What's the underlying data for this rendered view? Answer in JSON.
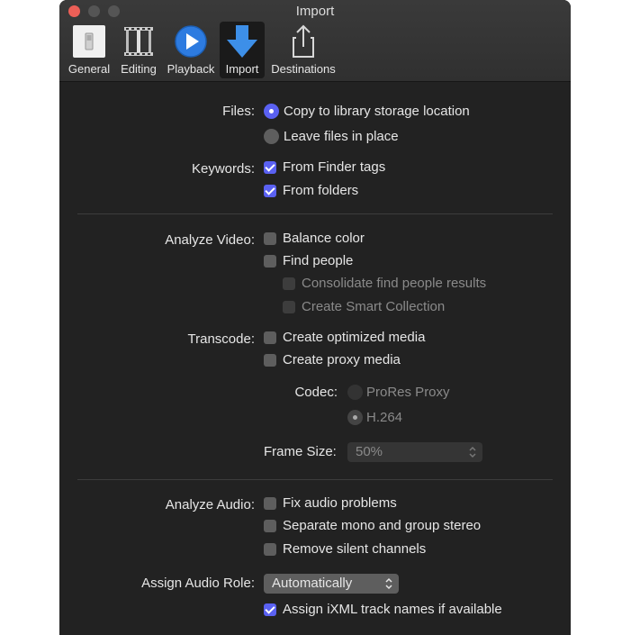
{
  "window": {
    "title": "Import"
  },
  "toolbar": {
    "items": [
      {
        "label": "General",
        "icon": "general-switch-icon"
      },
      {
        "label": "Editing",
        "icon": "filmstrip-icon"
      },
      {
        "label": "Playback",
        "icon": "play-icon"
      },
      {
        "label": "Import",
        "icon": "download-arrow-icon",
        "selected": true
      },
      {
        "label": "Destinations",
        "icon": "share-icon"
      }
    ]
  },
  "files": {
    "label": "Files:",
    "options": [
      {
        "label": "Copy to library storage location",
        "selected": true
      },
      {
        "label": "Leave files in place",
        "selected": false
      }
    ]
  },
  "keywords": {
    "label": "Keywords:",
    "options": [
      {
        "label": "From Finder tags",
        "checked": true
      },
      {
        "label": "From folders",
        "checked": true
      }
    ]
  },
  "analyze_video": {
    "label": "Analyze Video:",
    "balance_color": {
      "label": "Balance color",
      "checked": false
    },
    "find_people": {
      "label": "Find people",
      "checked": false
    },
    "consolidate": {
      "label": "Consolidate find people results",
      "checked": false,
      "enabled": false
    },
    "smart_collection": {
      "label": "Create Smart Collection",
      "checked": false,
      "enabled": false
    }
  },
  "transcode": {
    "label": "Transcode:",
    "optimized": {
      "label": "Create optimized media",
      "checked": false
    },
    "proxy": {
      "label": "Create proxy media",
      "checked": false
    },
    "codec_label": "Codec:",
    "codec_options": [
      {
        "label": "ProRes Proxy",
        "selected": false
      },
      {
        "label": "H.264",
        "selected": true
      }
    ],
    "frame_size_label": "Frame Size:",
    "frame_size_value": "50%"
  },
  "analyze_audio": {
    "label": "Analyze Audio:",
    "options": [
      {
        "label": "Fix audio problems",
        "checked": false
      },
      {
        "label": "Separate mono and group stereo",
        "checked": false
      },
      {
        "label": "Remove silent channels",
        "checked": false
      }
    ]
  },
  "audio_role": {
    "label": "Assign Audio Role:",
    "value": "Automatically",
    "ixml": {
      "label": "Assign iXML track names if available",
      "checked": true
    }
  },
  "colors": {
    "accent": "#5a61f2",
    "background": "#222222",
    "close": "#ec5f57"
  }
}
